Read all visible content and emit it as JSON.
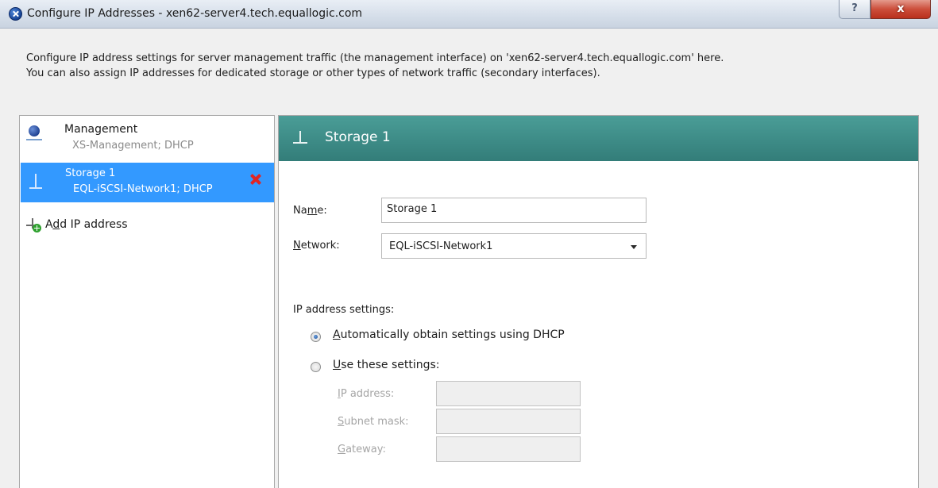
{
  "window": {
    "title": "Configure IP Addresses - xen62-server4.tech.equallogic.com",
    "help_label": "?",
    "close_label": "x"
  },
  "description": {
    "line1": "Configure IP address settings for server management traffic (the management interface) on 'xen62-server4.tech.equallogic.com' here.",
    "line2": "You can also assign IP addresses for dedicated storage or other types of network traffic (secondary interfaces)."
  },
  "interfaces": {
    "items": [
      {
        "title": "Management",
        "subtitle": "XS-Management; DHCP",
        "selected": false,
        "icon": "management-interface-icon"
      },
      {
        "title": "Storage 1",
        "subtitle": "EQL-iSCSI-Network1; DHCP",
        "selected": true,
        "icon": "storage-interface-icon",
        "has_remove": true
      }
    ],
    "add_label_pre": "A",
    "add_label_ul": "d",
    "add_label_post": "d IP address",
    "selected_color": "#3399ff"
  },
  "detail": {
    "header_title": "Storage 1",
    "header_color": "#3d8b86",
    "name_label_pre": "Na",
    "name_label_ul": "m",
    "name_label_post": "e:",
    "name_value": "Storage 1",
    "network_label_ul": "N",
    "network_label_post": "etwork:",
    "network_value": "EQL-iSCSI-Network1",
    "ip_settings_label": "IP address settings:",
    "dhcp_option_ul": "A",
    "dhcp_option_post": "utomatically obtain settings using DHCP",
    "dhcp_selected": true,
    "static_option_ul": "U",
    "static_option_post": "se these settings:",
    "static_selected": false,
    "ip_label_ul": "I",
    "ip_label_post": "P address:",
    "subnet_label_ul": "S",
    "subnet_label_post": "ubnet mask:",
    "gateway_label_ul": "G",
    "gateway_label_post": "ateway:",
    "ip_value": "",
    "subnet_value": "",
    "gateway_value": ""
  }
}
